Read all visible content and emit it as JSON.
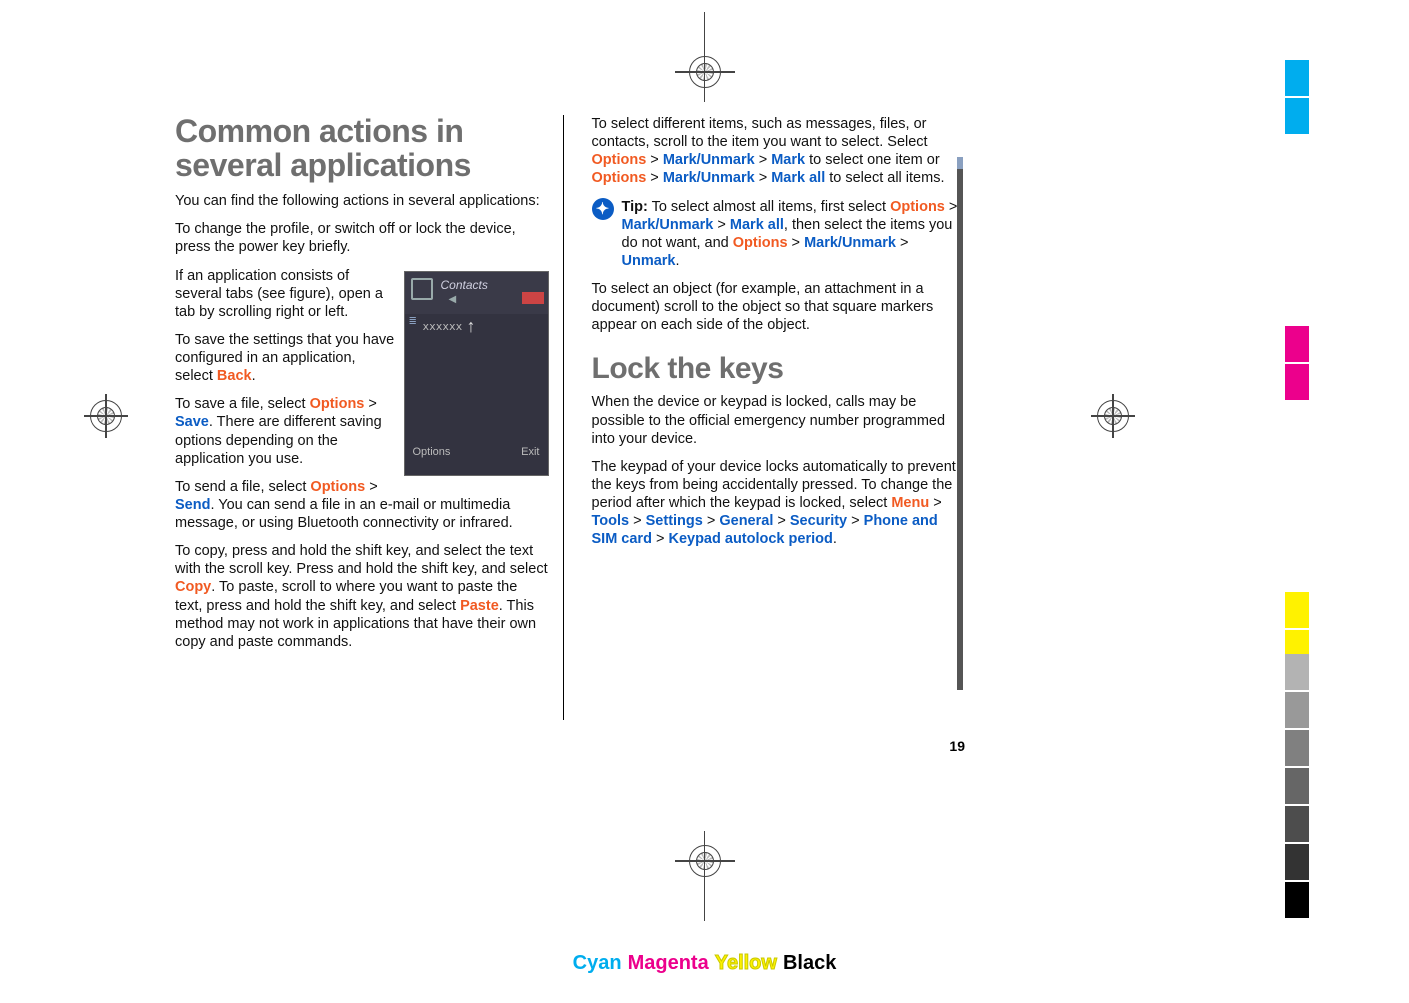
{
  "page_number": "19",
  "headings": {
    "h1": "Common actions in several applications",
    "h2": "Lock the keys"
  },
  "left": {
    "p1": "You can find the following actions in several applications:",
    "p2": "To change the profile, or switch off or lock the device, press the power key briefly.",
    "p3": "If an application consists of several tabs (see figure), open a tab by scrolling right or left.",
    "p4a": "To save the settings that you have configured in an application, select ",
    "p4b": "Back",
    "p4c": ".",
    "p5a": "To save a file, select ",
    "p5b": "Options",
    "p5c": " > ",
    "p5d": "Save",
    "p5e": ". There are different saving options depending on the application you use.",
    "p6a": "To send a file, select ",
    "p6b": "Options",
    "p6c": " > ",
    "p6d": "Send",
    "p6e": ". You can send a file in an e-mail or multimedia message, or using Bluetooth connectivity or infrared.",
    "p7a": "To copy, press and hold the shift key, and select the text with the scroll key. Press and hold the shift key, and select ",
    "p7b": "Copy",
    "p7c": ". To paste, scroll to where you want to paste the text, press and hold the shift key, and select ",
    "p7d": "Paste",
    "p7e": ". This method may not work in applications that have their own copy and paste commands."
  },
  "right": {
    "p1a": "To select different items, such as messages, files, or contacts, scroll to the item you want to select. Select ",
    "p1b": "Options",
    "p1c": " > ",
    "p1d": "Mark/Unmark",
    "p1e": " > ",
    "p1f": "Mark",
    "p1g": " to select one item or ",
    "p1h": "Options",
    "p1i": " > ",
    "p1j": "Mark/Unmark",
    "p1k": " > ",
    "p1l": "Mark all",
    "p1m": " to select all items.",
    "tipLabel": "Tip:",
    "tip_a": " To select almost all items, first select ",
    "tip_b": "Options",
    "tip_c": " > ",
    "tip_d": "Mark/Unmark",
    "tip_e": " > ",
    "tip_f": "Mark all",
    "tip_g": ", then select the items you do not want, and ",
    "tip_h": "Options",
    "tip_i": " > ",
    "tip_j": "Mark/Unmark",
    "tip_k": " > ",
    "tip_l": "Unmark",
    "tip_m": ".",
    "p3": "To select an object (for example, an attachment in a document) scroll to the object so that square markers appear on each side of the object.",
    "p4": "When the device or keypad is locked, calls may be possible to the official emergency number programmed into your device.",
    "p5a": "The keypad of your device locks automatically to prevent the keys from being accidentally pressed. To change the period after which the keypad is locked, select ",
    "p5b": "Menu",
    "p5c": " > ",
    "p5d": "Tools",
    "p5e": " > ",
    "p5f": "Settings",
    "p5g": " > ",
    "p5h": "General",
    "p5i": " > ",
    "p5j": "Security",
    "p5k": " > ",
    "p5l": "Phone and SIM card",
    "p5m": " > ",
    "p5n": "Keypad autolock period",
    "p5o": "."
  },
  "figure": {
    "title": "Contacts",
    "arrow": "◀",
    "entry": "xxxxxx",
    "optLeft": "Options",
    "optRight": "Exit"
  },
  "cmyk": {
    "c": "Cyan",
    "m": "Magenta",
    "y": "Yellow",
    "k": "Black"
  },
  "swatches": {
    "colors": [
      "#00adee",
      "#00adee",
      "#ec008c",
      "#ec008c",
      "#fff200",
      "#fff200"
    ],
    "greys": [
      "#b3b3b3",
      "#999999",
      "#808080",
      "#666666",
      "#4d4d4d",
      "#333333",
      "#000000"
    ]
  }
}
